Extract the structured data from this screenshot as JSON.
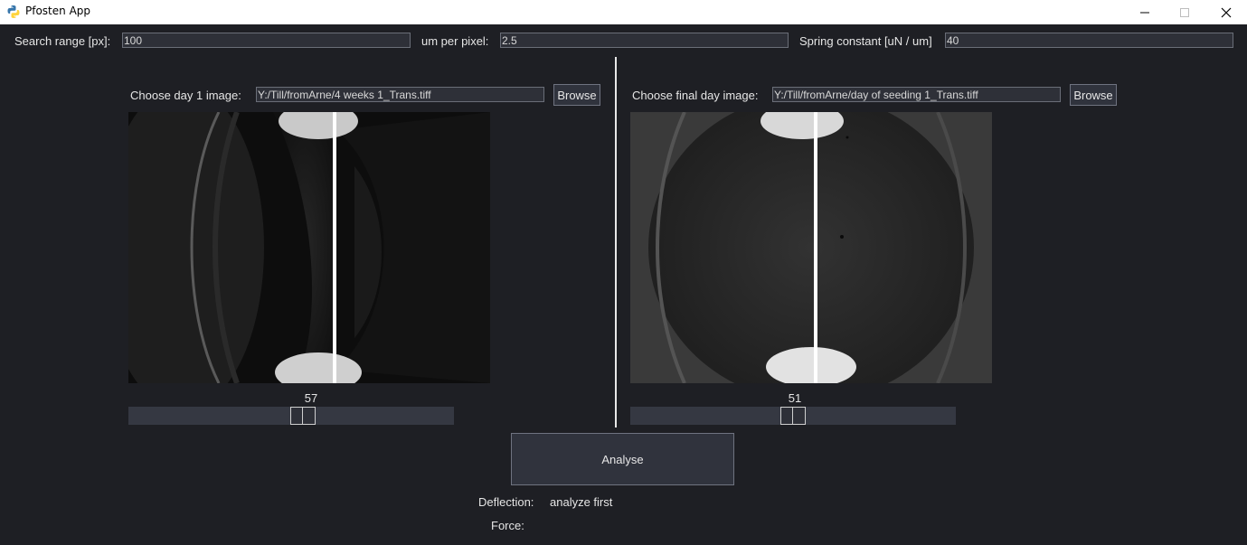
{
  "window": {
    "title": "Pfosten App"
  },
  "params": {
    "search_range_label": "Search range [px]:",
    "search_range_value": "100",
    "um_per_pixel_label": "um per pixel:",
    "um_per_pixel_value": "2.5",
    "spring_constant_label": "Spring constant [uN / um]",
    "spring_constant_value": "40"
  },
  "left_panel": {
    "choose_label": "Choose day 1 image:",
    "path_value": "Y:/Till/fromArne/4 weeks 1_Trans.tiff",
    "browse_label": "Browse",
    "slider_value": "57",
    "slider_fraction": 0.54
  },
  "right_panel": {
    "choose_label": "Choose final day image:",
    "path_value": "Y:/Till/fromArne/day of seeding 1_Trans.tiff",
    "browse_label": "Browse",
    "slider_value": "51",
    "slider_fraction": 0.5
  },
  "analyse": {
    "button_label": "Analyse"
  },
  "results": {
    "deflection_label": "Deflection:",
    "deflection_value": "analyze first",
    "force_label": "Force:",
    "force_value": ""
  }
}
